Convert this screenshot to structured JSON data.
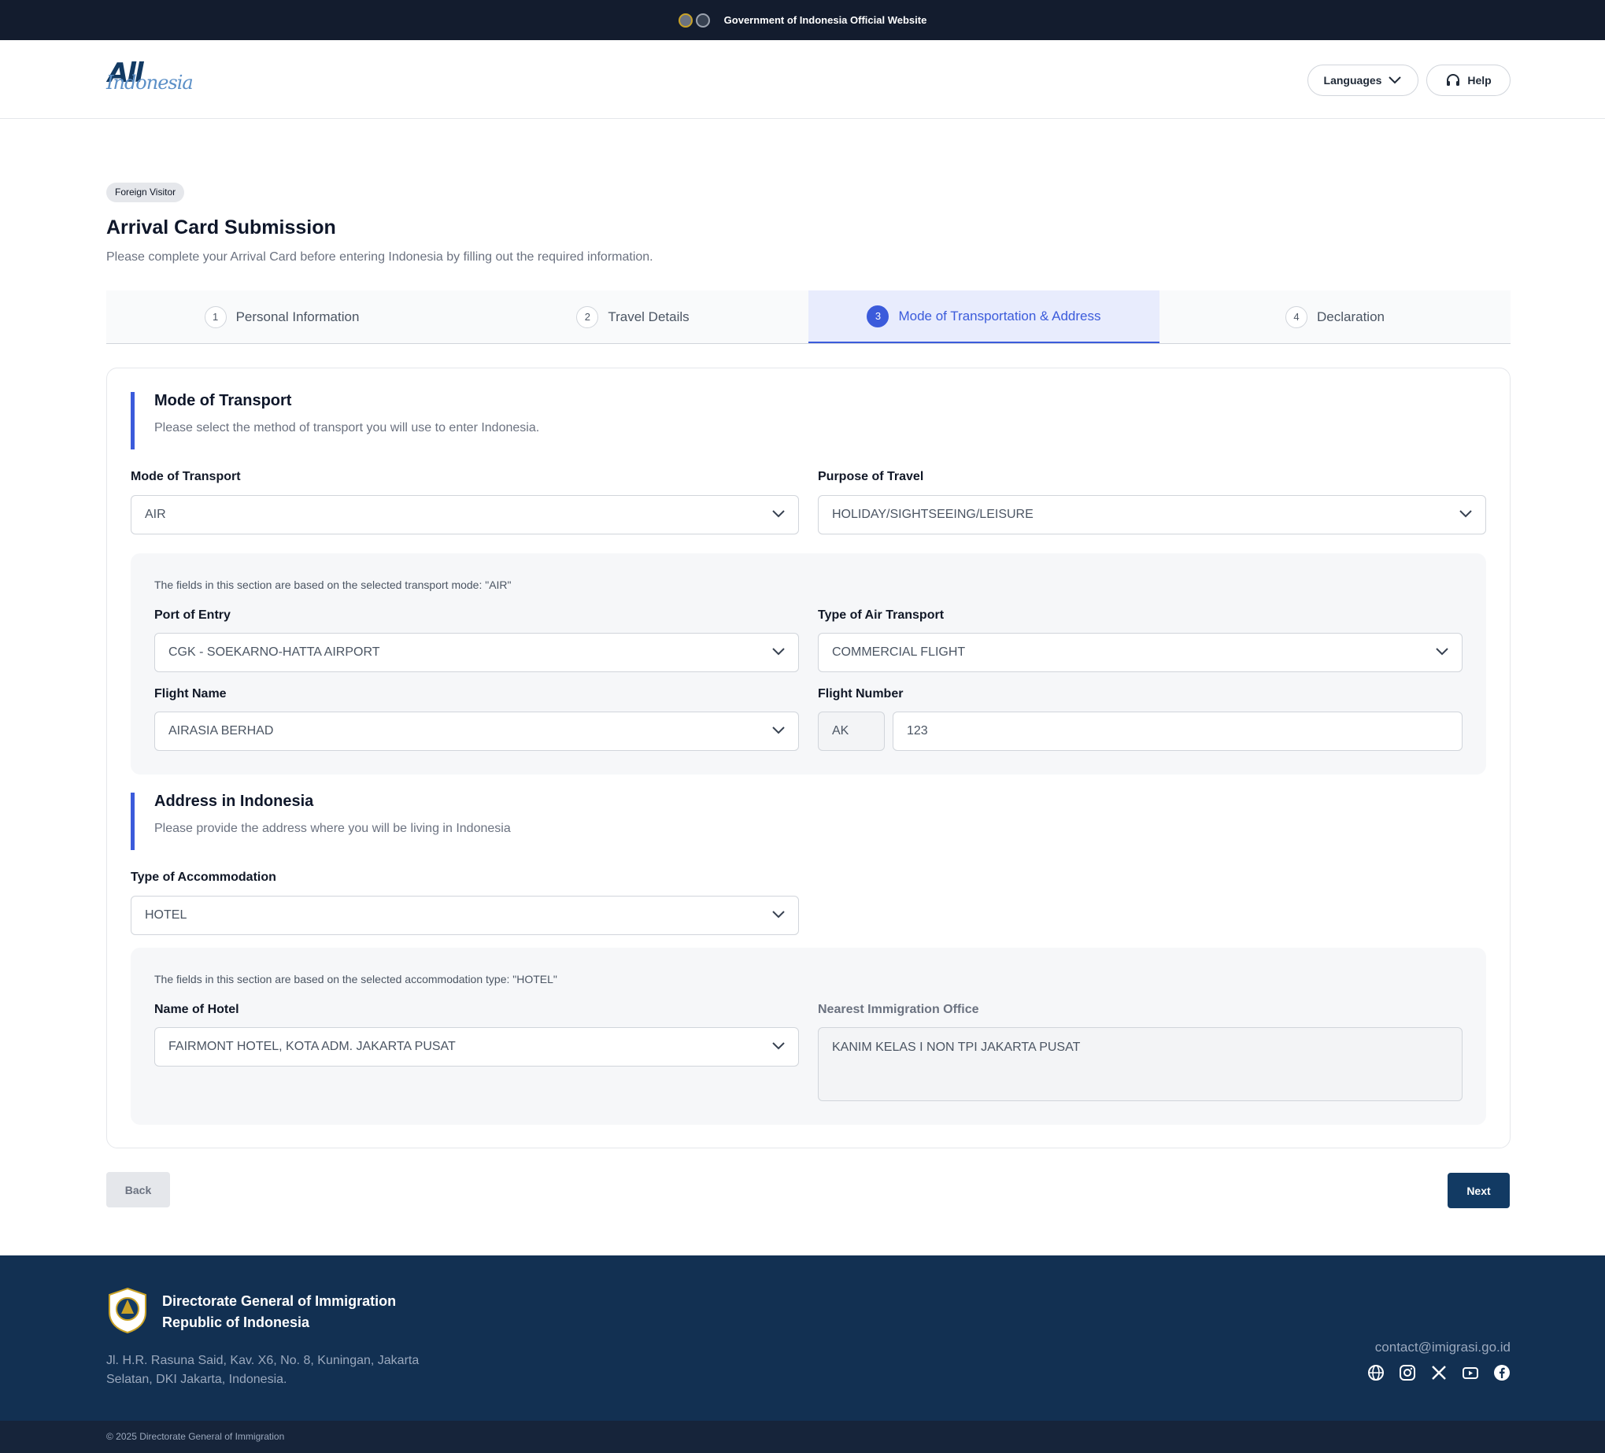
{
  "topbar": {
    "text": "Government of Indonesia Official Website"
  },
  "header": {
    "logo_top": "All",
    "logo_bottom": "Indonesia",
    "languages_label": "Languages",
    "help_label": "Help"
  },
  "page": {
    "badge": "Foreign Visitor",
    "title": "Arrival Card Submission",
    "subtitle": "Please complete your Arrival Card before entering Indonesia by filling out the required information."
  },
  "steps": [
    {
      "num": "1",
      "label": "Personal Information"
    },
    {
      "num": "2",
      "label": "Travel Details"
    },
    {
      "num": "3",
      "label": "Mode of Transportation & Address"
    },
    {
      "num": "4",
      "label": "Declaration"
    }
  ],
  "transport": {
    "heading": "Mode of Transport",
    "description": "Please select the method of transport you will use to enter Indonesia.",
    "mode_label": "Mode of Transport",
    "mode_value": "AIR",
    "purpose_label": "Purpose of Travel",
    "purpose_value": "HOLIDAY/SIGHTSEEING/LEISURE",
    "note": "The fields in this section are based on the selected transport mode: \"AIR\"",
    "port_label": "Port of Entry",
    "port_value": "CGK - SOEKARNO-HATTA AIRPORT",
    "air_type_label": "Type of Air Transport",
    "air_type_value": "COMMERCIAL FLIGHT",
    "flight_name_label": "Flight Name",
    "flight_name_value": "AIRASIA BERHAD",
    "flight_number_label": "Flight Number",
    "flight_prefix": "AK",
    "flight_number_value": "123"
  },
  "address": {
    "heading": "Address in Indonesia",
    "description": "Please provide the address where you will be living in Indonesia",
    "accommodation_label": "Type of Accommodation",
    "accommodation_value": "HOTEL",
    "note": "The fields in this section are based on the selected accommodation type: \"HOTEL\"",
    "hotel_label": "Name of Hotel",
    "hotel_value": "FAIRMONT HOTEL, KOTA ADM. JAKARTA PUSAT",
    "office_label": "Nearest Immigration Office",
    "office_value": "KANIM KELAS I NON TPI JAKARTA PUSAT"
  },
  "actions": {
    "back": "Back",
    "next": "Next"
  },
  "footer": {
    "org_line1": "Directorate General of Immigration",
    "org_line2": "Republic of Indonesia",
    "address": "Jl. H.R. Rasuna Said, Kav. X6, No. 8, Kuningan, Jakarta Selatan, DKI Jakarta, Indonesia.",
    "email": "contact@imigrasi.go.id",
    "social_icons": [
      "globe-icon",
      "instagram-icon",
      "x-icon",
      "youtube-icon",
      "facebook-icon"
    ],
    "copyright": "© 2025 Directorate General of Immigration"
  },
  "colors": {
    "accent": "#3b5bdb",
    "navy": "#123a63",
    "footer": "#123052",
    "topbar": "#131c2e"
  }
}
